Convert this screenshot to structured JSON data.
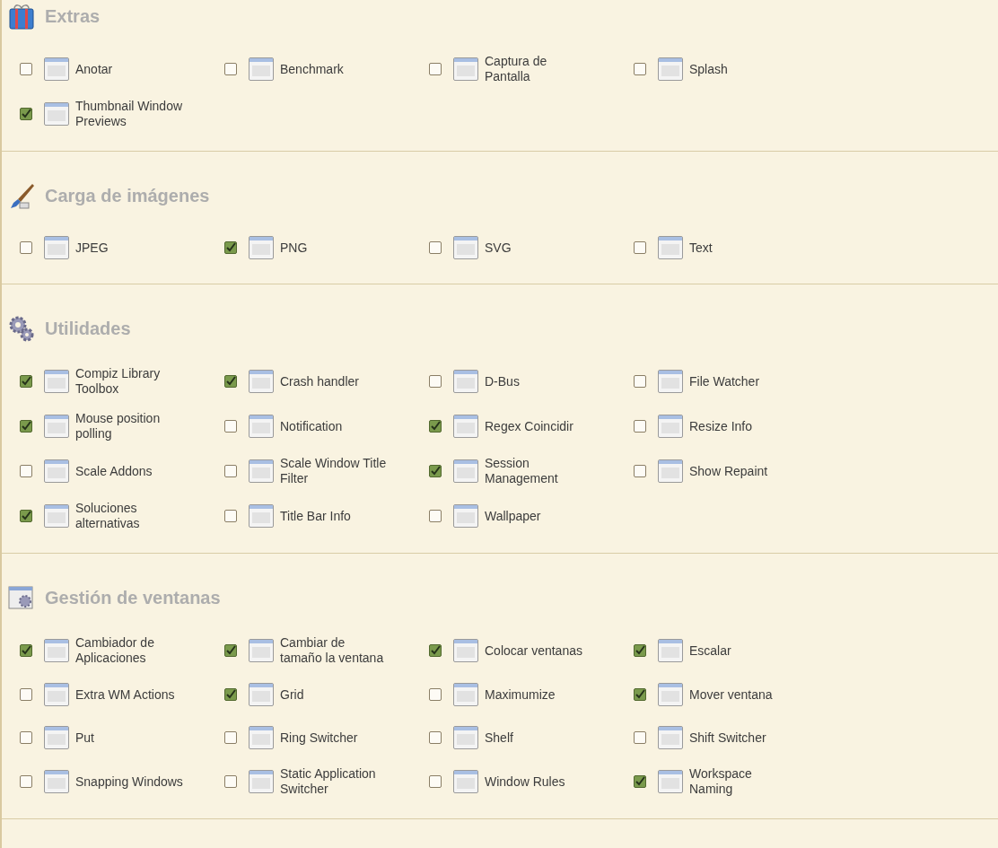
{
  "sections": [
    {
      "title": "Extras",
      "plugins": [
        {
          "label": "Anotar",
          "checked": false
        },
        {
          "label": "Benchmark",
          "checked": false
        },
        {
          "label": "Captura de Pantalla",
          "checked": false
        },
        {
          "label": "Splash",
          "checked": false
        },
        {
          "label": "Thumbnail Window Previews",
          "checked": true
        }
      ]
    },
    {
      "title": "Carga de imágenes",
      "plugins": [
        {
          "label": "JPEG",
          "checked": false
        },
        {
          "label": "PNG",
          "checked": true
        },
        {
          "label": "SVG",
          "checked": false
        },
        {
          "label": "Text",
          "checked": false
        }
      ]
    },
    {
      "title": "Utilidades",
      "plugins": [
        {
          "label": "Compiz Library Toolbox",
          "checked": true
        },
        {
          "label": "Crash handler",
          "checked": true
        },
        {
          "label": "D-Bus",
          "checked": false
        },
        {
          "label": "File Watcher",
          "checked": false
        },
        {
          "label": "Mouse position polling",
          "checked": true
        },
        {
          "label": "Notification",
          "checked": false
        },
        {
          "label": "Regex Coincidir",
          "checked": true
        },
        {
          "label": "Resize Info",
          "checked": false
        },
        {
          "label": "Scale Addons",
          "checked": false
        },
        {
          "label": "Scale Window Title Filter",
          "checked": false
        },
        {
          "label": "Session Management",
          "checked": true
        },
        {
          "label": "Show Repaint",
          "checked": false
        },
        {
          "label": "Soluciones alternativas",
          "checked": true
        },
        {
          "label": "Title Bar Info",
          "checked": false
        },
        {
          "label": "Wallpaper",
          "checked": false
        }
      ]
    },
    {
      "title": "Gestión de ventanas",
      "plugins": [
        {
          "label": "Cambiador de Aplicaciones",
          "checked": true
        },
        {
          "label": "Cambiar de tamaño la ventana",
          "checked": true
        },
        {
          "label": "Colocar ventanas",
          "checked": true
        },
        {
          "label": "Escalar",
          "checked": true
        },
        {
          "label": "Extra WM Actions",
          "checked": false
        },
        {
          "label": "Grid",
          "checked": true
        },
        {
          "label": "Maximumize",
          "checked": false
        },
        {
          "label": "Mover ventana",
          "checked": true
        },
        {
          "label": "Put",
          "checked": false
        },
        {
          "label": "Ring Switcher",
          "checked": false
        },
        {
          "label": "Shelf",
          "checked": false
        },
        {
          "label": "Shift Switcher",
          "checked": false
        },
        {
          "label": "Snapping Windows",
          "checked": false
        },
        {
          "label": "Static Application Switcher",
          "checked": false
        },
        {
          "label": "Window Rules",
          "checked": false
        },
        {
          "label": "Workspace Naming",
          "checked": true
        }
      ]
    }
  ]
}
